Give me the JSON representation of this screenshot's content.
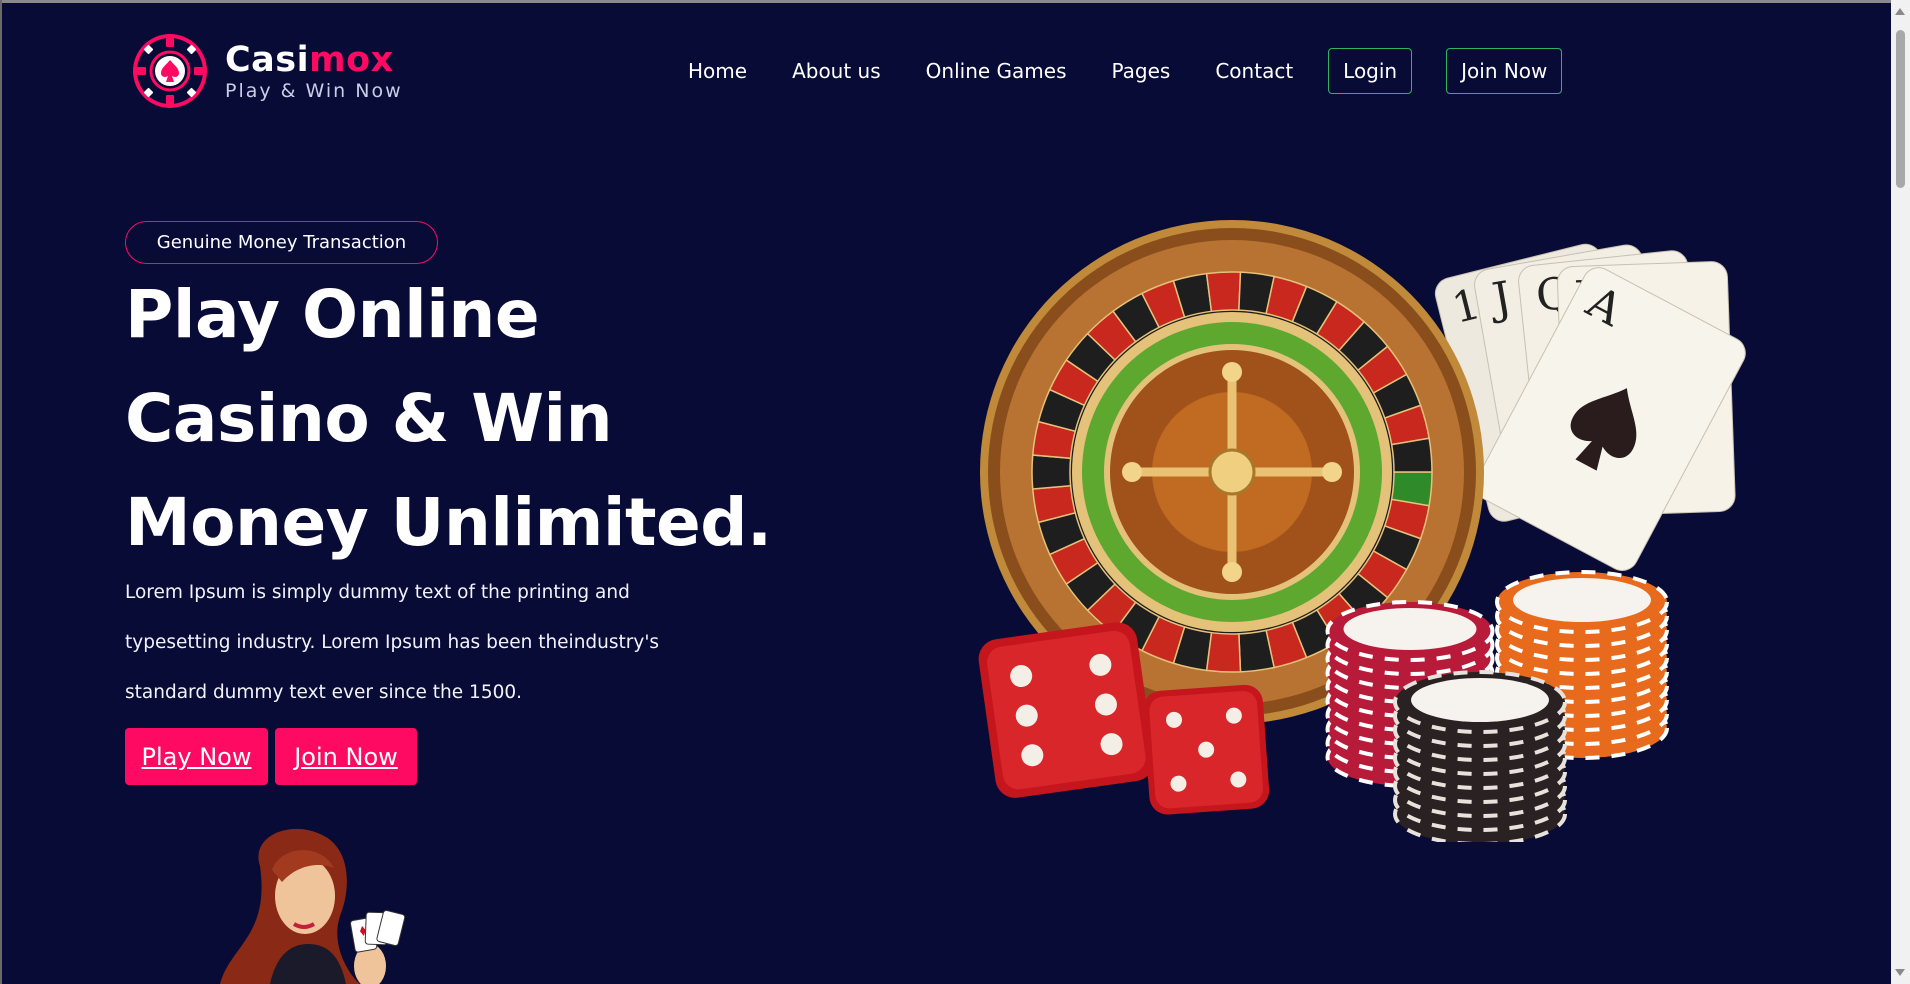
{
  "header": {
    "logo": {
      "name_part1": "Casi",
      "name_part2": "mox",
      "tagline": "Play & Win Now",
      "icon": "poker-chip-spade-icon"
    },
    "nav": [
      {
        "label": "Home"
      },
      {
        "label": "About us"
      },
      {
        "label": "Online Games"
      },
      {
        "label": "Pages"
      },
      {
        "label": "Contact"
      }
    ],
    "login_label": "Login",
    "join_label": "Join Now"
  },
  "hero": {
    "badge": "Genuine Money Transaction",
    "headline_lines": [
      "Play Online",
      "Casino & Win",
      "Money Unlimited."
    ],
    "description": "Lorem Ipsum is simply dummy text of the printing and typesetting industry. Lorem Ipsum has been theindustry's standard dummy text ever since the 1500.",
    "play_label": "Play Now",
    "join_label": "Join Now",
    "art_icons": [
      "roulette-wheel-icon",
      "playing-cards-icon",
      "dice-icon",
      "casino-chips-icon"
    ],
    "woman_illustration": "woman-with-cards-icon"
  },
  "colors": {
    "background": "#070b36",
    "accent": "#ff0a62",
    "outline_green": "#2fb561",
    "text": "#ffffff"
  }
}
